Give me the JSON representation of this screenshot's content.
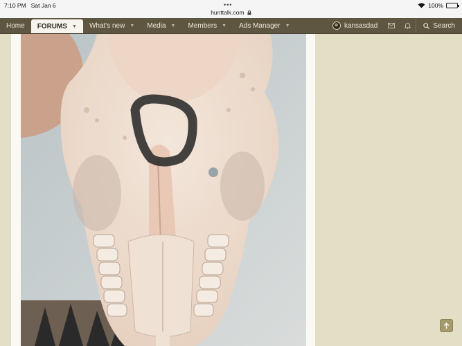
{
  "status_bar": {
    "time": "7:10 PM",
    "date": "Sat Jan 6",
    "url": "hunttalk.com",
    "battery": "100%",
    "battery_level": 1.0
  },
  "navbar": {
    "items": [
      {
        "label": "Home",
        "active": false,
        "has_menu": false
      },
      {
        "label": "FORUMS",
        "active": true,
        "has_menu": true
      },
      {
        "label": "What's new",
        "active": false,
        "has_menu": true
      },
      {
        "label": "Media",
        "active": false,
        "has_menu": true
      },
      {
        "label": "Members",
        "active": false,
        "has_menu": true
      },
      {
        "label": "Ads Manager",
        "active": false,
        "has_menu": true
      }
    ],
    "username": "kansasdad",
    "search_label": "Search"
  },
  "icons": {
    "wifi": "wifi-icon",
    "lock": "lock-icon",
    "caret": "chevron-down-icon",
    "inbox": "envelope-icon",
    "alerts": "bell-icon",
    "search": "search-icon",
    "scroll_top": "arrow-up-icon"
  },
  "colors": {
    "nav_bg": "#5f5642",
    "page_bg": "#e3dfc6",
    "accent": "#a69a6d"
  }
}
